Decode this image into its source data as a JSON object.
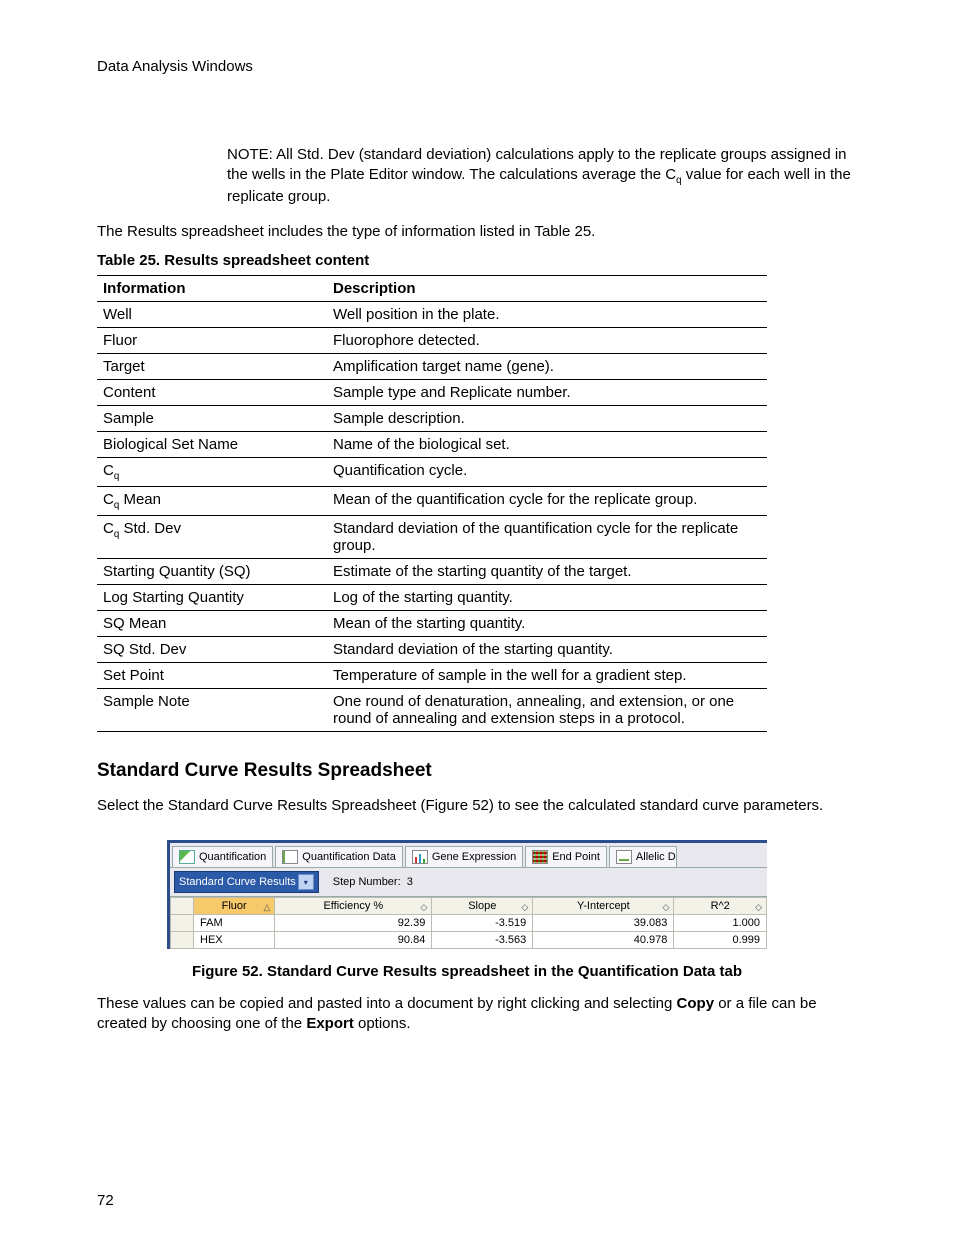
{
  "header": {
    "running": "Data Analysis Windows"
  },
  "note": {
    "text_pre": "NOTE: All Std. Dev (standard deviation) calculations apply to the replicate groups assigned in the wells in the Plate Editor window. The calculations average the C",
    "text_post": " value for each well in the replicate group.",
    "sub": "q"
  },
  "intro": "The Results spreadsheet includes the type of information listed in Table 25.",
  "table25": {
    "caption": "Table 25. Results spreadsheet content",
    "head_info": "Information",
    "head_desc": "Description",
    "rows": [
      {
        "info": "Well",
        "desc": "Well position in the plate."
      },
      {
        "info": "Fluor",
        "desc": "Fluorophore detected."
      },
      {
        "info": "Target",
        "desc": "Amplification target name (gene)."
      },
      {
        "info": "Content",
        "desc": "Sample type and Replicate number."
      },
      {
        "info": "Sample",
        "desc": "Sample description."
      },
      {
        "info": "Biological Set Name",
        "desc": "Name of the biological set."
      },
      {
        "info": "C_q",
        "desc": "Quantification cycle.",
        "sub": "q",
        "prefix": "C"
      },
      {
        "info": "C_q Mean",
        "desc": "Mean of the quantification cycle for the replicate group.",
        "sub": "q",
        "prefix": "C",
        "suffix": " Mean"
      },
      {
        "info": "C_q Std. Dev",
        "desc": "Standard deviation of the quantification cycle for the replicate group.",
        "sub": "q",
        "prefix": "C",
        "suffix": " Std. Dev"
      },
      {
        "info": "Starting Quantity (SQ)",
        "desc": "Estimate of the starting quantity of the target."
      },
      {
        "info": "Log Starting Quantity",
        "desc": "Log of the starting quantity."
      },
      {
        "info": "SQ Mean",
        "desc": "Mean of the starting quantity."
      },
      {
        "info": "SQ Std. Dev",
        "desc": "Standard deviation of the starting quantity."
      },
      {
        "info": "Set Point",
        "desc": "Temperature of sample in the well for a gradient step."
      },
      {
        "info": "Sample Note",
        "desc": "One round of denaturation, annealing, and extension, or one round of annealing and extension steps in a protocol."
      }
    ]
  },
  "section": {
    "heading": "Standard Curve Results Spreadsheet",
    "para": "Select the Standard Curve Results Spreadsheet (Figure 52) to see the calculated standard curve parameters."
  },
  "figure": {
    "tabs": {
      "t1": "Quantification",
      "t2": "Quantification Data",
      "t3": "Gene Expression",
      "t4": "End Point",
      "t5": "Allelic D"
    },
    "dropdown": "Standard Curve Results",
    "step_label": "Step Number:",
    "step_value": "3",
    "cols": {
      "fluor": "Fluor",
      "eff": "Efficiency %",
      "slope": "Slope",
      "yint": "Y-Intercept",
      "r2": "R^2"
    },
    "rows": [
      {
        "fluor": "FAM",
        "eff": "92.39",
        "slope": "-3.519",
        "yint": "39.083",
        "r2": "1.000"
      },
      {
        "fluor": "HEX",
        "eff": "90.84",
        "slope": "-3.563",
        "yint": "40.978",
        "r2": "0.999"
      }
    ],
    "caption": "Figure 52. Standard Curve Results spreadsheet in the Quantification Data tab"
  },
  "closing": {
    "pre": "These values can be copied and pasted into a document by right clicking and selecting ",
    "bold1": "Copy",
    "mid": " or a file can be created by choosing one of the ",
    "bold2": "Export",
    "post": " options."
  },
  "page_number": "72",
  "chart_data": {
    "type": "table",
    "title": "Standard Curve Results",
    "columns": [
      "Fluor",
      "Efficiency %",
      "Slope",
      "Y-Intercept",
      "R^2"
    ],
    "rows": [
      [
        "FAM",
        92.39,
        -3.519,
        39.083,
        1.0
      ],
      [
        "HEX",
        90.84,
        -3.563,
        40.978,
        0.999
      ]
    ],
    "step_number": 3
  }
}
